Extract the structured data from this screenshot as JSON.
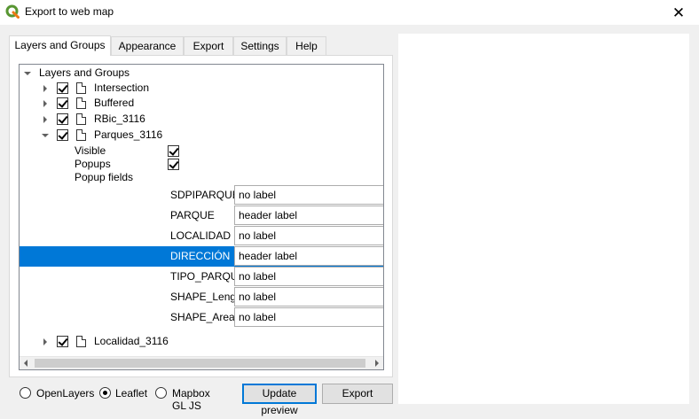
{
  "window": {
    "title": "Export to web map",
    "close_icon": "close-icon"
  },
  "tabs": [
    {
      "label": "Layers and Groups",
      "active": true
    },
    {
      "label": "Appearance",
      "active": false
    },
    {
      "label": "Export",
      "active": false
    },
    {
      "label": "Settings",
      "active": false
    },
    {
      "label": "Help",
      "active": false
    }
  ],
  "tree": {
    "root_label": "Layers and Groups",
    "layers": [
      {
        "name": "Intersection",
        "checked": true,
        "expanded": false
      },
      {
        "name": "Buffered",
        "checked": true,
        "expanded": false
      },
      {
        "name": "RBic_3116",
        "checked": true,
        "expanded": false
      },
      {
        "name": "Parques_3116",
        "checked": true,
        "expanded": true
      },
      {
        "name": "Localidad_3116",
        "checked": true,
        "expanded": false
      }
    ],
    "parques_options": {
      "visible_label": "Visible",
      "visible_checked": true,
      "popups_label": "Popups",
      "popups_checked": true,
      "popup_fields_label": "Popup fields"
    },
    "popup_fields": [
      {
        "name": "SDPIPARQUE",
        "value": "no label",
        "selected": false
      },
      {
        "name": "PARQUE",
        "value": "header label",
        "selected": false
      },
      {
        "name": "LOCALIDAD",
        "value": "no label",
        "selected": false
      },
      {
        "name": "DIRECCIÓN",
        "value": "header label",
        "selected": true
      },
      {
        "name": "TIPO_PARQU",
        "value": "no label",
        "selected": false
      },
      {
        "name": "SHAPE_Leng",
        "value": "no label",
        "selected": false
      },
      {
        "name": "SHAPE_Area",
        "value": "no label",
        "selected": false
      }
    ]
  },
  "map_libraries": [
    {
      "label": "OpenLayers",
      "selected": false
    },
    {
      "label": "Leaflet",
      "selected": true
    },
    {
      "label": "Mapbox GL JS",
      "selected": false
    }
  ],
  "buttons": {
    "update_preview": "Update preview",
    "export": "Export"
  },
  "colors": {
    "selection": "#0078d7",
    "qgis_green": "#589632"
  }
}
